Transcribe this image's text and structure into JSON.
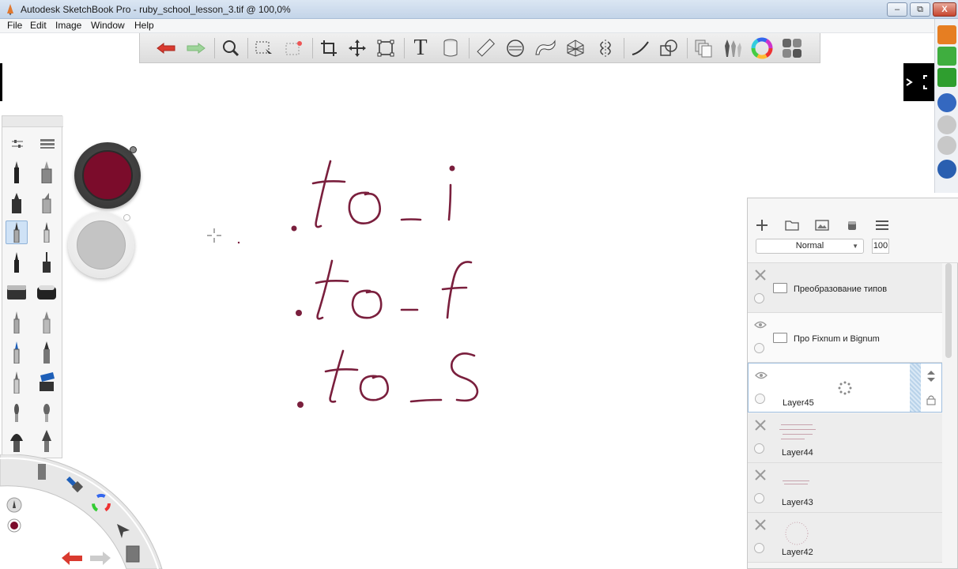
{
  "window": {
    "title": "Autodesk SketchBook Pro - ruby_school_lesson_3.tif @ 100,0%",
    "minimize": "–",
    "maximize": "⧉",
    "close": "X"
  },
  "menu": [
    "File",
    "Edit",
    "Image",
    "Window",
    "Help"
  ],
  "toolbar": {
    "text_tool_glyph": "T"
  },
  "colors": {
    "primary": "#7b0c2b",
    "secondary": "#c4c4c4",
    "ink": "#7a1f3d"
  },
  "canvas": {
    "line1": ".to_i",
    "line2": ".to_f",
    "line3": ".to_s"
  },
  "layers": {
    "blend_mode": "Normal",
    "opacity": "100",
    "items": [
      {
        "name": "Преобразование типов",
        "type": "group",
        "visible": false
      },
      {
        "name": "Про Fixnum и Bignum",
        "type": "group",
        "visible": true
      },
      {
        "name": "Layer45",
        "type": "layer",
        "visible": true,
        "selected": true
      },
      {
        "name": "Layer44",
        "type": "layer",
        "visible": false
      },
      {
        "name": "Layer43",
        "type": "layer",
        "visible": false
      },
      {
        "name": "Layer42",
        "type": "layer",
        "visible": false
      }
    ]
  }
}
